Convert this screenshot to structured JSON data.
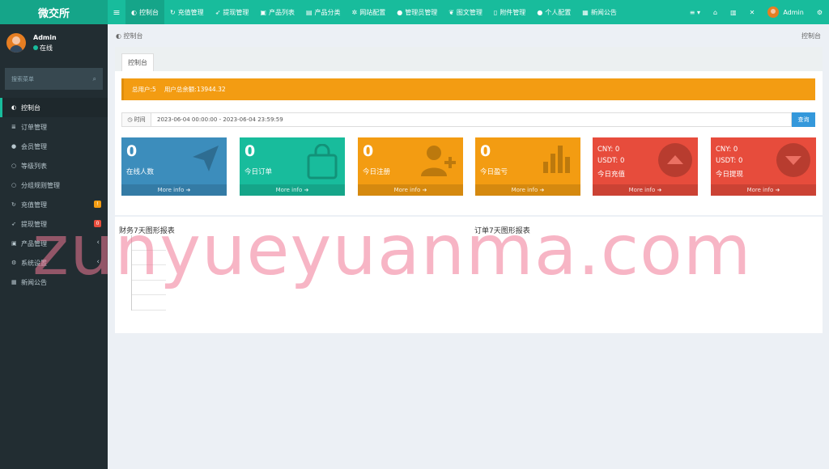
{
  "app": {
    "logo": "微交所"
  },
  "topnav": {
    "toggle_icon": "bars-icon",
    "items": [
      {
        "label": "控制台",
        "icon": "dashboard-icon",
        "active": true
      },
      {
        "label": "充值管理",
        "icon": "refresh-icon"
      },
      {
        "label": "提现管理",
        "icon": "rocket-icon"
      },
      {
        "label": "产品列表",
        "icon": "briefcase-icon"
      },
      {
        "label": "产品分类",
        "icon": "id-card-icon"
      },
      {
        "label": "网站配置",
        "icon": "gear-icon"
      },
      {
        "label": "管理员管理",
        "icon": "user-icon"
      },
      {
        "label": "图文管理",
        "icon": "leaf-icon"
      },
      {
        "label": "附件管理",
        "icon": "file-icon"
      },
      {
        "label": "个人配置",
        "icon": "user-icon"
      },
      {
        "label": "新闻公告",
        "icon": "newspaper-icon"
      }
    ],
    "right": {
      "username": "Admin"
    }
  },
  "sidebar": {
    "user": {
      "name": "Admin",
      "status": "在线"
    },
    "search_placeholder": "搜索菜单",
    "items": [
      {
        "label": "控制台",
        "icon": "dashboard-icon",
        "active": true
      },
      {
        "label": "订单管理",
        "icon": "list-icon"
      },
      {
        "label": "会员管理",
        "icon": "users-icon"
      },
      {
        "label": "等级列表",
        "icon": "circle-icon"
      },
      {
        "label": "分组规则管理",
        "icon": "circle-icon"
      },
      {
        "label": "充值管理",
        "icon": "refresh-icon",
        "badge": "!"
      },
      {
        "label": "提现管理",
        "icon": "rocket-icon",
        "badge": "0"
      },
      {
        "label": "产品管理",
        "icon": "briefcase-icon",
        "chevron": true
      },
      {
        "label": "系统设置",
        "icon": "gears-icon",
        "chevron": true
      },
      {
        "label": "新闻公告",
        "icon": "newspaper-icon"
      }
    ]
  },
  "breadcrumb": {
    "left": "控制台",
    "right": "控制台"
  },
  "panel": {
    "tab": "控制台",
    "alert": {
      "users": "总用户:5",
      "balance": "用户总余额:13944.32"
    },
    "date": {
      "label": "时间",
      "value": "2023-06-04 00:00:00 - 2023-06-04 23:59:59",
      "button": "查询"
    }
  },
  "stats": [
    {
      "value": "0",
      "label": "在线人数",
      "more": "More info",
      "color": "#3c8dbc",
      "icon": "paper-plane-icon"
    },
    {
      "value": "0",
      "label": "今日订单",
      "more": "More info",
      "color": "#18bc9c",
      "icon": "shopping-bag-icon"
    },
    {
      "value": "0",
      "label": "今日注册",
      "more": "More info",
      "color": "#f39c12",
      "icon": "user-plus-icon"
    },
    {
      "value": "0",
      "label": "今日盈亏",
      "more": "More info",
      "color": "#f39c12",
      "icon": "bar-chart-icon"
    },
    {
      "line1": "CNY:  0",
      "line2": "USDT:  0",
      "label": "今日充值",
      "more": "More info",
      "color": "#e74c3c",
      "icon": "arrow-up-circle-icon"
    },
    {
      "line1": "CNY:  0",
      "line2": "USDT:  0",
      "label": "今日提现",
      "more": "More info",
      "color": "#e74c3c",
      "icon": "arrow-down-circle-icon"
    }
  ],
  "charts": {
    "left_title": "财务7天图形报表",
    "right_title": "订单7天图形报表"
  },
  "watermark": "zunyueyuanma.com"
}
